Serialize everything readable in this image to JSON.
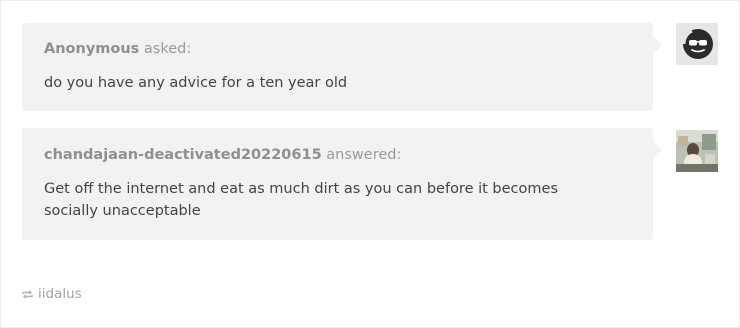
{
  "question": {
    "asker": "Anonymous",
    "verb": "asked:",
    "text": "do you have any advice for a ten year old"
  },
  "answer": {
    "answerer": "chandajaan-deactivated20220615",
    "verb": "answered:",
    "text": "Get off the internet and eat as much dirt as you can before it becomes socially unacceptable"
  },
  "reblog": {
    "username": "iidalus",
    "icon": "reblog-icon"
  },
  "avatars": {
    "asker_icon": "anonymous-sunglasses-icon",
    "answerer_icon": "user-photo-avatar"
  }
}
